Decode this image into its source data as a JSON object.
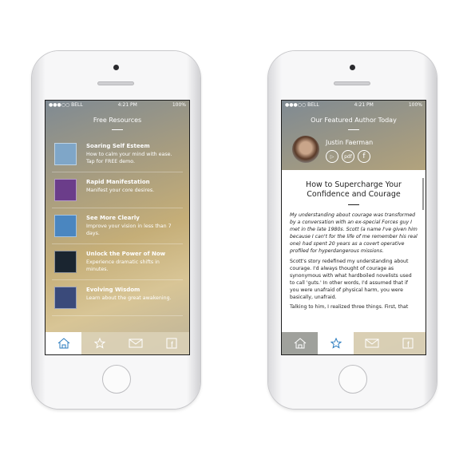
{
  "status": {
    "carrier": "●●●○○ BELL",
    "time": "4:21 PM",
    "battery": "100%"
  },
  "left": {
    "title": "Free Resources",
    "items": [
      {
        "title": "Soaring Self Esteem",
        "desc": "How to calm your mind with ease. Tap for FREE demo.",
        "color": "#7fa6c8"
      },
      {
        "title": "Rapid Manifestation",
        "desc": "Manifest your core desires.",
        "color": "#6b3d8a"
      },
      {
        "title": "See More Clearly",
        "desc": "Improve your vision in less than 7 days.",
        "color": "#4a86c0"
      },
      {
        "title": "Unlock the Power of Now",
        "desc": "Experience dramatic shifts in minutes.",
        "color": "#1a2530"
      },
      {
        "title": "Evolving Wisdom",
        "desc": "Learn about the great awakening.",
        "color": "#3a4a7a"
      }
    ]
  },
  "right": {
    "title": "Our Featured Author Today",
    "author": "Justin Faerman",
    "pdf": "pdf",
    "fb": "f",
    "article_title": "How to Supercharge Your Confidence and Courage",
    "intro": "My understanding about courage was transformed by a conversation with an ex-special Forces guy I met in the late 1980s. Scott (a name I've given him because I can't for the life of me remember his real one) had spent 20 years as a covert operative profiled for hyperdangerous missions.",
    "p1": "Scott's story redefined my understanding about courage. I'd always thought of courage as synonymous with what hardboiled novelists used to call 'guts.' In other words, I'd assumed that if you were unafraid of physical harm, you were basically, unafraid.",
    "p2": "Talking to him, I realized three things. First, that"
  },
  "tabs": [
    "home",
    "favorites",
    "mail",
    "facebook"
  ],
  "accent": "#2a7bbf"
}
